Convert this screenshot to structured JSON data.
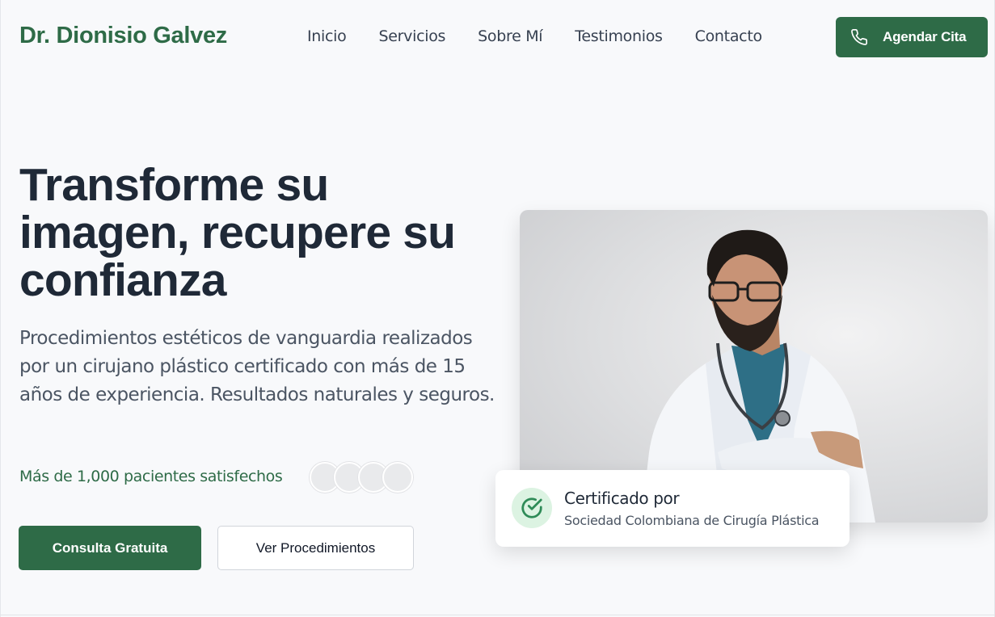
{
  "header": {
    "logo": "Dr. Dionisio Galvez",
    "nav": [
      "Inicio",
      "Servicios",
      "Sobre Mí",
      "Testimonios",
      "Contacto"
    ],
    "cta_label": "Agendar Cita",
    "cta_icon": "phone-icon"
  },
  "hero": {
    "title": "Transforme su imagen, recupere su confianza",
    "subtitle": "Procedimientos estéticos de vanguardia realizados por un cirujano plástico certificado con más de 15 años de experiencia. Resultados naturales y seguros.",
    "social_proof": "Más de 1,000 pacientes satisfechos",
    "primary_button": "Consulta Gratuita",
    "secondary_button": "Ver Procedimientos"
  },
  "certificate": {
    "title": "Certificado por",
    "subtitle": "Sociedad Colombiana de Cirugía Plástica",
    "icon": "check-circle-icon"
  },
  "colors": {
    "brand": "#2e6b47",
    "text_dark": "#1f2937",
    "text_muted": "#4b5563",
    "background": "#f8f9fb",
    "cert_icon_bg": "#dcf3e2"
  }
}
